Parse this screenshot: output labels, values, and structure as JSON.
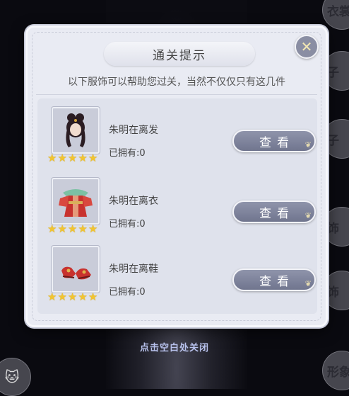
{
  "background": {
    "side_tabs": [
      "衣裳",
      "子",
      "子",
      "饰",
      "饰",
      "形象"
    ],
    "close_hint": "点击空白处关闭"
  },
  "dialog": {
    "title": "通关提示",
    "subtitle": "以下服饰可以帮助您过关，当然不仅仅只有这几件",
    "close_label": "✕",
    "items": [
      {
        "name": "朱明在离发",
        "owned": "已拥有:0",
        "stars": 5,
        "button": "查看",
        "icon": "hair-icon"
      },
      {
        "name": "朱明在离衣",
        "owned": "已拥有:0",
        "stars": 5,
        "button": "查看",
        "icon": "dress-icon"
      },
      {
        "name": "朱明在离鞋",
        "owned": "已拥有:0",
        "stars": 5,
        "button": "查看",
        "icon": "shoes-icon"
      }
    ]
  }
}
